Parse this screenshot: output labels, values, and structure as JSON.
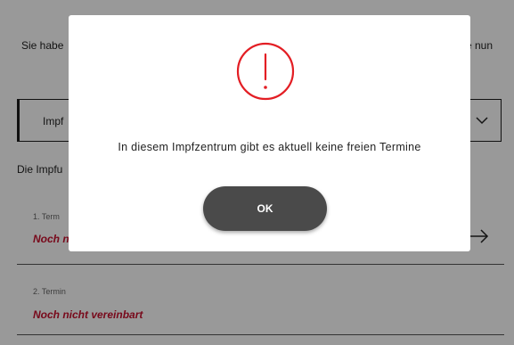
{
  "background": {
    "intro_left": "Sie habe",
    "intro_right": "e nun",
    "select_value": "Impf",
    "vaccination_label": "Die Impfu",
    "termine": [
      {
        "label": "1. Term",
        "status": "Noch n"
      },
      {
        "label": "2. Termin",
        "status": "Noch nicht vereinbart"
      }
    ],
    "status_color": "#c8102e"
  },
  "modal": {
    "icon": "exclamation-circle-icon",
    "icon_color": "#e31e24",
    "message": "In diesem Impfzentrum gibt es aktuell keine freien Termine",
    "ok_label": "OK"
  }
}
